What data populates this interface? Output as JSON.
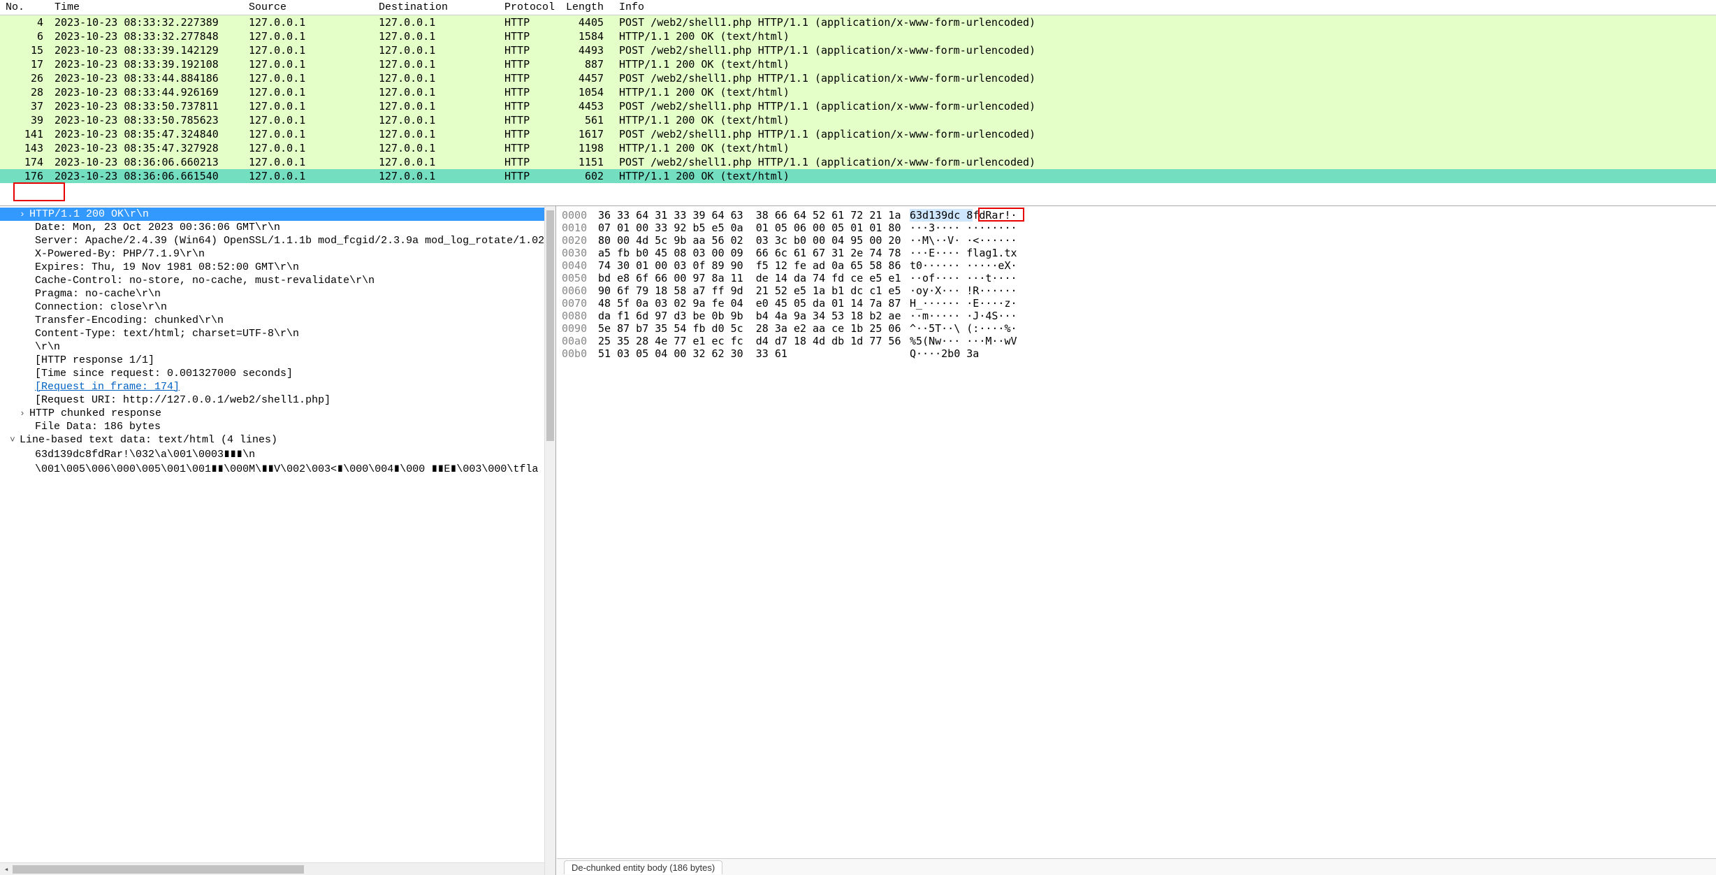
{
  "columns": {
    "no": "No.",
    "time": "Time",
    "source": "Source",
    "destination": "Destination",
    "protocol": "Protocol",
    "length": "Length",
    "info": "Info"
  },
  "packets": [
    {
      "no": 4,
      "time": "2023-10-23 08:33:32.227389",
      "src": "127.0.0.1",
      "dst": "127.0.0.1",
      "proto": "HTTP",
      "len": 4405,
      "info": "POST /web2/shell1.php HTTP/1.1  (application/x-www-form-urlencoded)",
      "cls": "green"
    },
    {
      "no": 6,
      "time": "2023-10-23 08:33:32.277848",
      "src": "127.0.0.1",
      "dst": "127.0.0.1",
      "proto": "HTTP",
      "len": 1584,
      "info": "HTTP/1.1 200 OK  (text/html)",
      "cls": "green"
    },
    {
      "no": 15,
      "time": "2023-10-23 08:33:39.142129",
      "src": "127.0.0.1",
      "dst": "127.0.0.1",
      "proto": "HTTP",
      "len": 4493,
      "info": "POST /web2/shell1.php HTTP/1.1  (application/x-www-form-urlencoded)",
      "cls": "green"
    },
    {
      "no": 17,
      "time": "2023-10-23 08:33:39.192108",
      "src": "127.0.0.1",
      "dst": "127.0.0.1",
      "proto": "HTTP",
      "len": 887,
      "info": "HTTP/1.1 200 OK  (text/html)",
      "cls": "green"
    },
    {
      "no": 26,
      "time": "2023-10-23 08:33:44.884186",
      "src": "127.0.0.1",
      "dst": "127.0.0.1",
      "proto": "HTTP",
      "len": 4457,
      "info": "POST /web2/shell1.php HTTP/1.1  (application/x-www-form-urlencoded)",
      "cls": "green"
    },
    {
      "no": 28,
      "time": "2023-10-23 08:33:44.926169",
      "src": "127.0.0.1",
      "dst": "127.0.0.1",
      "proto": "HTTP",
      "len": 1054,
      "info": "HTTP/1.1 200 OK  (text/html)",
      "cls": "green"
    },
    {
      "no": 37,
      "time": "2023-10-23 08:33:50.737811",
      "src": "127.0.0.1",
      "dst": "127.0.0.1",
      "proto": "HTTP",
      "len": 4453,
      "info": "POST /web2/shell1.php HTTP/1.1  (application/x-www-form-urlencoded)",
      "cls": "green"
    },
    {
      "no": 39,
      "time": "2023-10-23 08:33:50.785623",
      "src": "127.0.0.1",
      "dst": "127.0.0.1",
      "proto": "HTTP",
      "len": 561,
      "info": "HTTP/1.1 200 OK  (text/html)",
      "cls": "green"
    },
    {
      "no": 141,
      "time": "2023-10-23 08:35:47.324840",
      "src": "127.0.0.1",
      "dst": "127.0.0.1",
      "proto": "HTTP",
      "len": 1617,
      "info": "POST /web2/shell1.php HTTP/1.1  (application/x-www-form-urlencoded)",
      "cls": "green"
    },
    {
      "no": 143,
      "time": "2023-10-23 08:35:47.327928",
      "src": "127.0.0.1",
      "dst": "127.0.0.1",
      "proto": "HTTP",
      "len": 1198,
      "info": "HTTP/1.1 200 OK  (text/html)",
      "cls": "green"
    },
    {
      "no": 174,
      "time": "2023-10-23 08:36:06.660213",
      "src": "127.0.0.1",
      "dst": "127.0.0.1",
      "proto": "HTTP",
      "len": 1151,
      "info": "POST /web2/shell1.php HTTP/1.1  (application/x-www-form-urlencoded)",
      "cls": "green"
    },
    {
      "no": 176,
      "time": "2023-10-23 08:36:06.661540",
      "src": "127.0.0.1",
      "dst": "127.0.0.1",
      "proto": "HTTP",
      "len": 602,
      "info": "HTTP/1.1 200 OK  (text/html)",
      "cls": "sel"
    }
  ],
  "details": [
    {
      "cls": "col sel",
      "text": "HTTP/1.1 200 OK\\r\\n"
    },
    {
      "cls": "",
      "text": "Date: Mon, 23 Oct 2023 00:36:06 GMT\\r\\n"
    },
    {
      "cls": "",
      "text": "Server: Apache/2.4.39 (Win64) OpenSSL/1.1.1b mod_fcgid/2.3.9a mod_log_rotate/1.02"
    },
    {
      "cls": "",
      "text": "X-Powered-By: PHP/7.1.9\\r\\n"
    },
    {
      "cls": "",
      "text": "Expires: Thu, 19 Nov 1981 08:52:00 GMT\\r\\n"
    },
    {
      "cls": "",
      "text": "Cache-Control: no-store, no-cache, must-revalidate\\r\\n"
    },
    {
      "cls": "",
      "text": "Pragma: no-cache\\r\\n"
    },
    {
      "cls": "",
      "text": "Connection: close\\r\\n"
    },
    {
      "cls": "",
      "text": "Transfer-Encoding: chunked\\r\\n"
    },
    {
      "cls": "",
      "text": "Content-Type: text/html; charset=UTF-8\\r\\n"
    },
    {
      "cls": "",
      "text": "\\r\\n"
    },
    {
      "cls": "",
      "text": "[HTTP response 1/1]"
    },
    {
      "cls": "",
      "text": "[Time since request: 0.001327000 seconds]"
    },
    {
      "cls": "link-row",
      "text": "[Request in frame: 174]"
    },
    {
      "cls": "",
      "text": "[Request URI: http://127.0.0.1/web2/shell1.php]"
    },
    {
      "cls": "col",
      "text": "HTTP chunked response"
    },
    {
      "cls": "",
      "text": "File Data: 186 bytes"
    },
    {
      "cls": "exp root",
      "text": "Line-based text data: text/html (4 lines)"
    },
    {
      "cls": "",
      "text": "63d139dc8fdRar!\\032\\a\\001\\0003∎∎∎\\n"
    },
    {
      "cls": "",
      "text": "\\001\\005\\006\\000\\005\\001\\001∎∎\\000M\\∎∎V\\002\\003<∎\\000\\004∎\\000 ∎∎E∎\\003\\000\\tfla"
    }
  ],
  "hex": [
    {
      "off": "0000",
      "bytes": "36 33 64 31 33 39 64 63  38 66 64 52 61 72 21 1a",
      "ascii": "63d139dc 8fdRar!·",
      "special": "first"
    },
    {
      "off": "0010",
      "bytes": "07 01 00 33 92 b5 e5 0a  01 05 06 00 05 01 01 80",
      "ascii": "···3···· ········"
    },
    {
      "off": "0020",
      "bytes": "80 00 4d 5c 9b aa 56 02  03 3c b0 00 04 95 00 20",
      "ascii": "··M\\··V· ·<······"
    },
    {
      "off": "0030",
      "bytes": "a5 fb b0 45 08 03 00 09  66 6c 61 67 31 2e 74 78",
      "ascii": "···E···· flag1.tx"
    },
    {
      "off": "0040",
      "bytes": "74 30 01 00 03 0f 89 90  f5 12 fe ad 0a 65 58 86",
      "ascii": "t0······ ·····eX·"
    },
    {
      "off": "0050",
      "bytes": "bd e8 6f 66 00 97 8a 11  de 14 da 74 fd ce e5 e1",
      "ascii": "··of···· ···t····"
    },
    {
      "off": "0060",
      "bytes": "90 6f 79 18 58 a7 ff 9d  21 52 e5 1a b1 dc c1 e5",
      "ascii": "·oy·X··· !R······"
    },
    {
      "off": "0070",
      "bytes": "48 5f 0a 03 02 9a fe 04  e0 45 05 da 01 14 7a 87",
      "ascii": "H_······ ·E····z·"
    },
    {
      "off": "0080",
      "bytes": "da f1 6d 97 d3 be 0b 9b  b4 4a 9a 34 53 18 b2 ae",
      "ascii": "··m····· ·J·4S···"
    },
    {
      "off": "0090",
      "bytes": "5e 87 b7 35 54 fb d0 5c  28 3a e2 aa ce 1b 25 06",
      "ascii": "^··5T··\\ (:····%·"
    },
    {
      "off": "00a0",
      "bytes": "25 35 28 4e 77 e1 ec fc  d4 d7 18 4d db 1d 77 56",
      "ascii": "%5(Nw··· ···M··wV"
    },
    {
      "off": "00b0",
      "bytes": "51 03 05 04 00 32 62 30  33 61",
      "ascii": "Q····2b0 3a"
    }
  ],
  "tab_label": "De-chunked entity body (186 bytes)"
}
